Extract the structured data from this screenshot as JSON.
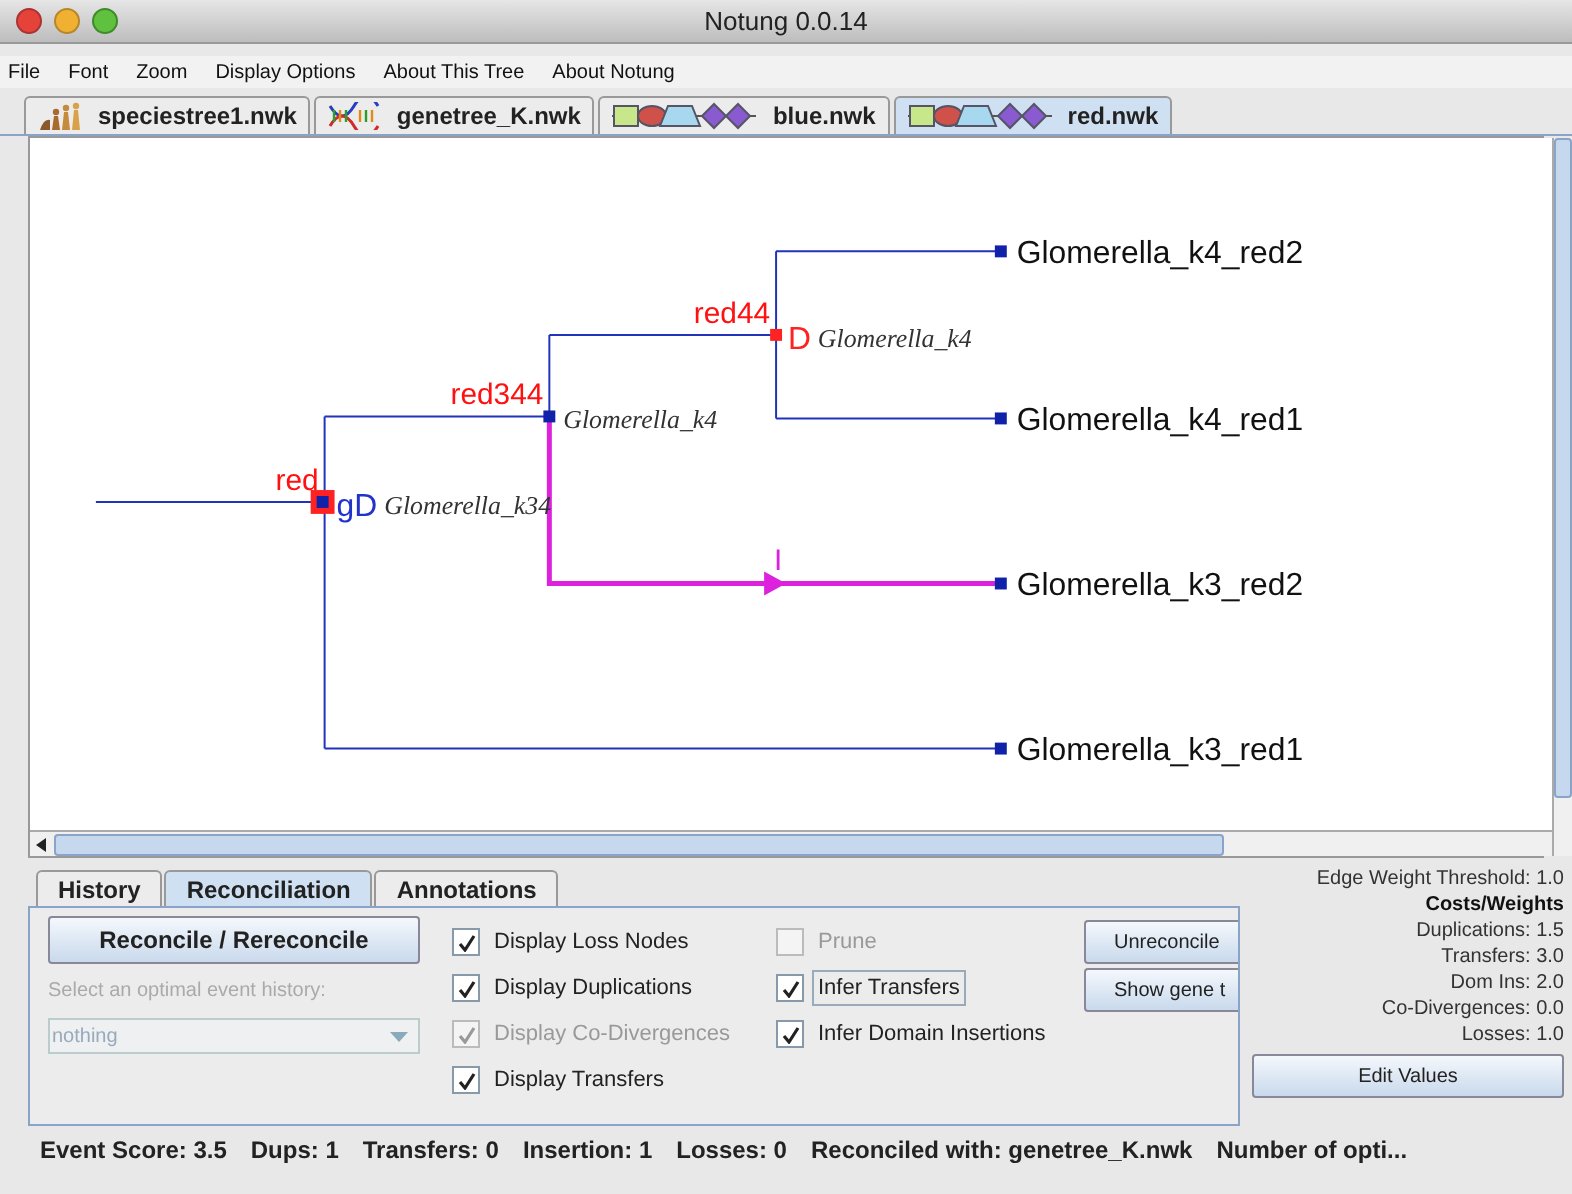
{
  "window": {
    "title": "Notung 0.0.14"
  },
  "menu": [
    "File",
    "Font",
    "Zoom",
    "Display Options",
    "About This Tree",
    "About Notung"
  ],
  "file_tabs": [
    {
      "label": "speciestree1.nwk",
      "kind": "species",
      "selected": false
    },
    {
      "label": "genetree_K.nwk",
      "kind": "dna",
      "selected": false
    },
    {
      "label": "blue.nwk",
      "kind": "domains",
      "selected": false
    },
    {
      "label": "red.nwk",
      "kind": "domains",
      "selected": true
    }
  ],
  "tree": {
    "nodes": [
      {
        "tag": "red",
        "event": "gD",
        "color": "#2233cc",
        "species": "Glomerella_k34"
      },
      {
        "tag": "red344",
        "species": "Glomerella_k4"
      },
      {
        "tag": "red44",
        "event": "D",
        "color": "#ff2222",
        "species": "Glomerella_k4"
      }
    ],
    "transfer_label": "I",
    "leaves": [
      "Glomerella_k4_red2",
      "Glomerella_k4_red1",
      "Glomerella_k3_red2",
      "Glomerella_k3_red1"
    ]
  },
  "panel_tabs": [
    {
      "label": "History",
      "selected": false
    },
    {
      "label": "Reconciliation",
      "selected": true
    },
    {
      "label": "Annotations",
      "selected": false
    }
  ],
  "reconcile_button": "Reconcile / Rereconcile",
  "history_select": {
    "label": "Select an optimal event history:",
    "value": "nothing",
    "disabled": true
  },
  "options_left": [
    {
      "label": "Display Loss Nodes",
      "checked": true,
      "disabled": false
    },
    {
      "label": "Display Duplications",
      "checked": true,
      "disabled": false
    },
    {
      "label": "Display Co-Divergences",
      "checked": true,
      "disabled": true
    },
    {
      "label": "Display Transfers",
      "checked": true,
      "disabled": false
    }
  ],
  "options_right": [
    {
      "label": "Prune",
      "checked": false,
      "disabled": true,
      "focused": false
    },
    {
      "label": "Infer Transfers",
      "checked": true,
      "disabled": false,
      "focused": true
    },
    {
      "label": "Infer Domain Insertions",
      "checked": true,
      "disabled": false,
      "focused": false
    }
  ],
  "side_buttons": [
    "Unreconcile",
    "Show gene t"
  ],
  "edge_weight": "Edge Weight Threshold: 1.0",
  "costs_title": "Costs/Weights",
  "costs": [
    "Duplications: 1.5",
    "Transfers: 3.0",
    "Dom Ins: 2.0",
    "Co-Divergences: 0.0",
    "Losses: 1.0"
  ],
  "edit_button": "Edit Values",
  "status": [
    "Event Score: 3.5",
    "Dups: 1",
    "Transfers: 0",
    "Insertion: 1",
    "Losses: 0",
    "Reconciled with: genetree_K.nwk",
    "Number of opti..."
  ]
}
